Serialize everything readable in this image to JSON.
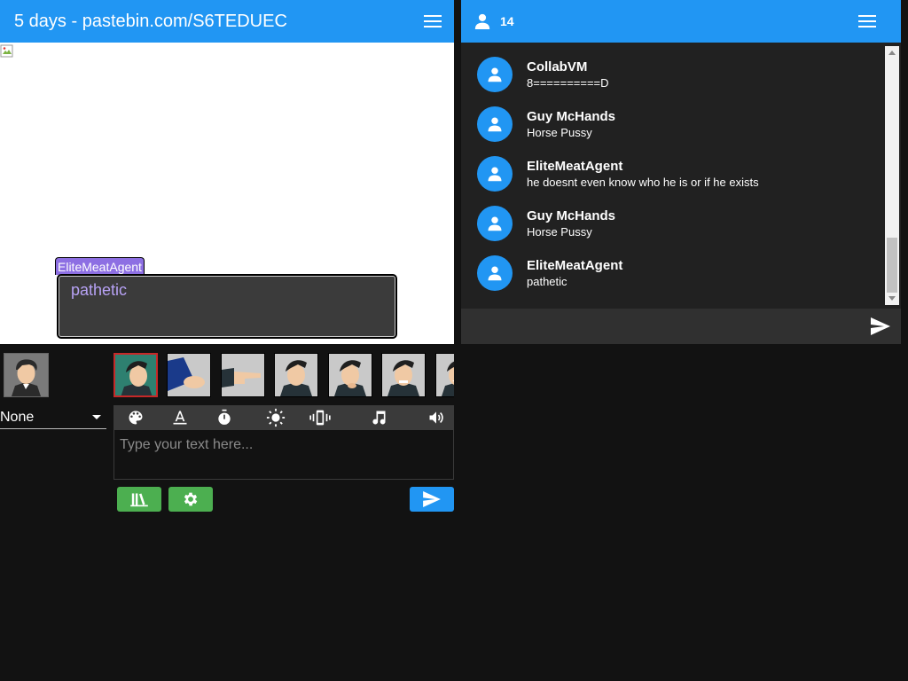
{
  "left_header": {
    "title": "5 days - pastebin.com/S6TEDUEC",
    "menu_icon": "hamburger-menu-icon"
  },
  "viewport": {
    "nameplate": "EliteMeatAgent",
    "message": "pathetic",
    "nameplate_color": "#8d6fe3",
    "message_color": "#b7a2f5"
  },
  "character": {
    "selected": "None"
  },
  "emotes": [
    {
      "name": "emote-1",
      "selected": true
    },
    {
      "name": "emote-2",
      "selected": false
    },
    {
      "name": "emote-3",
      "selected": false
    },
    {
      "name": "emote-4",
      "selected": false
    },
    {
      "name": "emote-5",
      "selected": false
    },
    {
      "name": "emote-6",
      "selected": false
    },
    {
      "name": "emote-7",
      "selected": false
    }
  ],
  "toolbar": {
    "icons": [
      "palette-icon",
      "text-color-icon",
      "timer-icon",
      "brightness-icon",
      "vibrate-icon",
      "music-note-icon",
      "volume-icon"
    ]
  },
  "input": {
    "placeholder": "Type your text here..."
  },
  "buttons": {
    "library_icon": "library-icon",
    "settings_icon": "gear-icon",
    "send_icon": "send-icon"
  },
  "right_header": {
    "user_count": "14",
    "user_icon": "person-icon",
    "menu_icon": "hamburger-menu-icon"
  },
  "chat": {
    "messages": [
      {
        "user": "CollabVM",
        "text": "8==========D"
      },
      {
        "user": "Guy McHands",
        "text": "Horse Pussy"
      },
      {
        "user": "EliteMeatAgent",
        "text": "he doesnt even know who he is or if he exists"
      },
      {
        "user": "Guy McHands",
        "text": "Horse Pussy"
      },
      {
        "user": "EliteMeatAgent",
        "text": "pathetic"
      }
    ],
    "input_placeholder": ""
  },
  "colors": {
    "accent": "#2196f3",
    "green": "#4caf50",
    "background": "#121212",
    "chat_background": "#212121"
  }
}
